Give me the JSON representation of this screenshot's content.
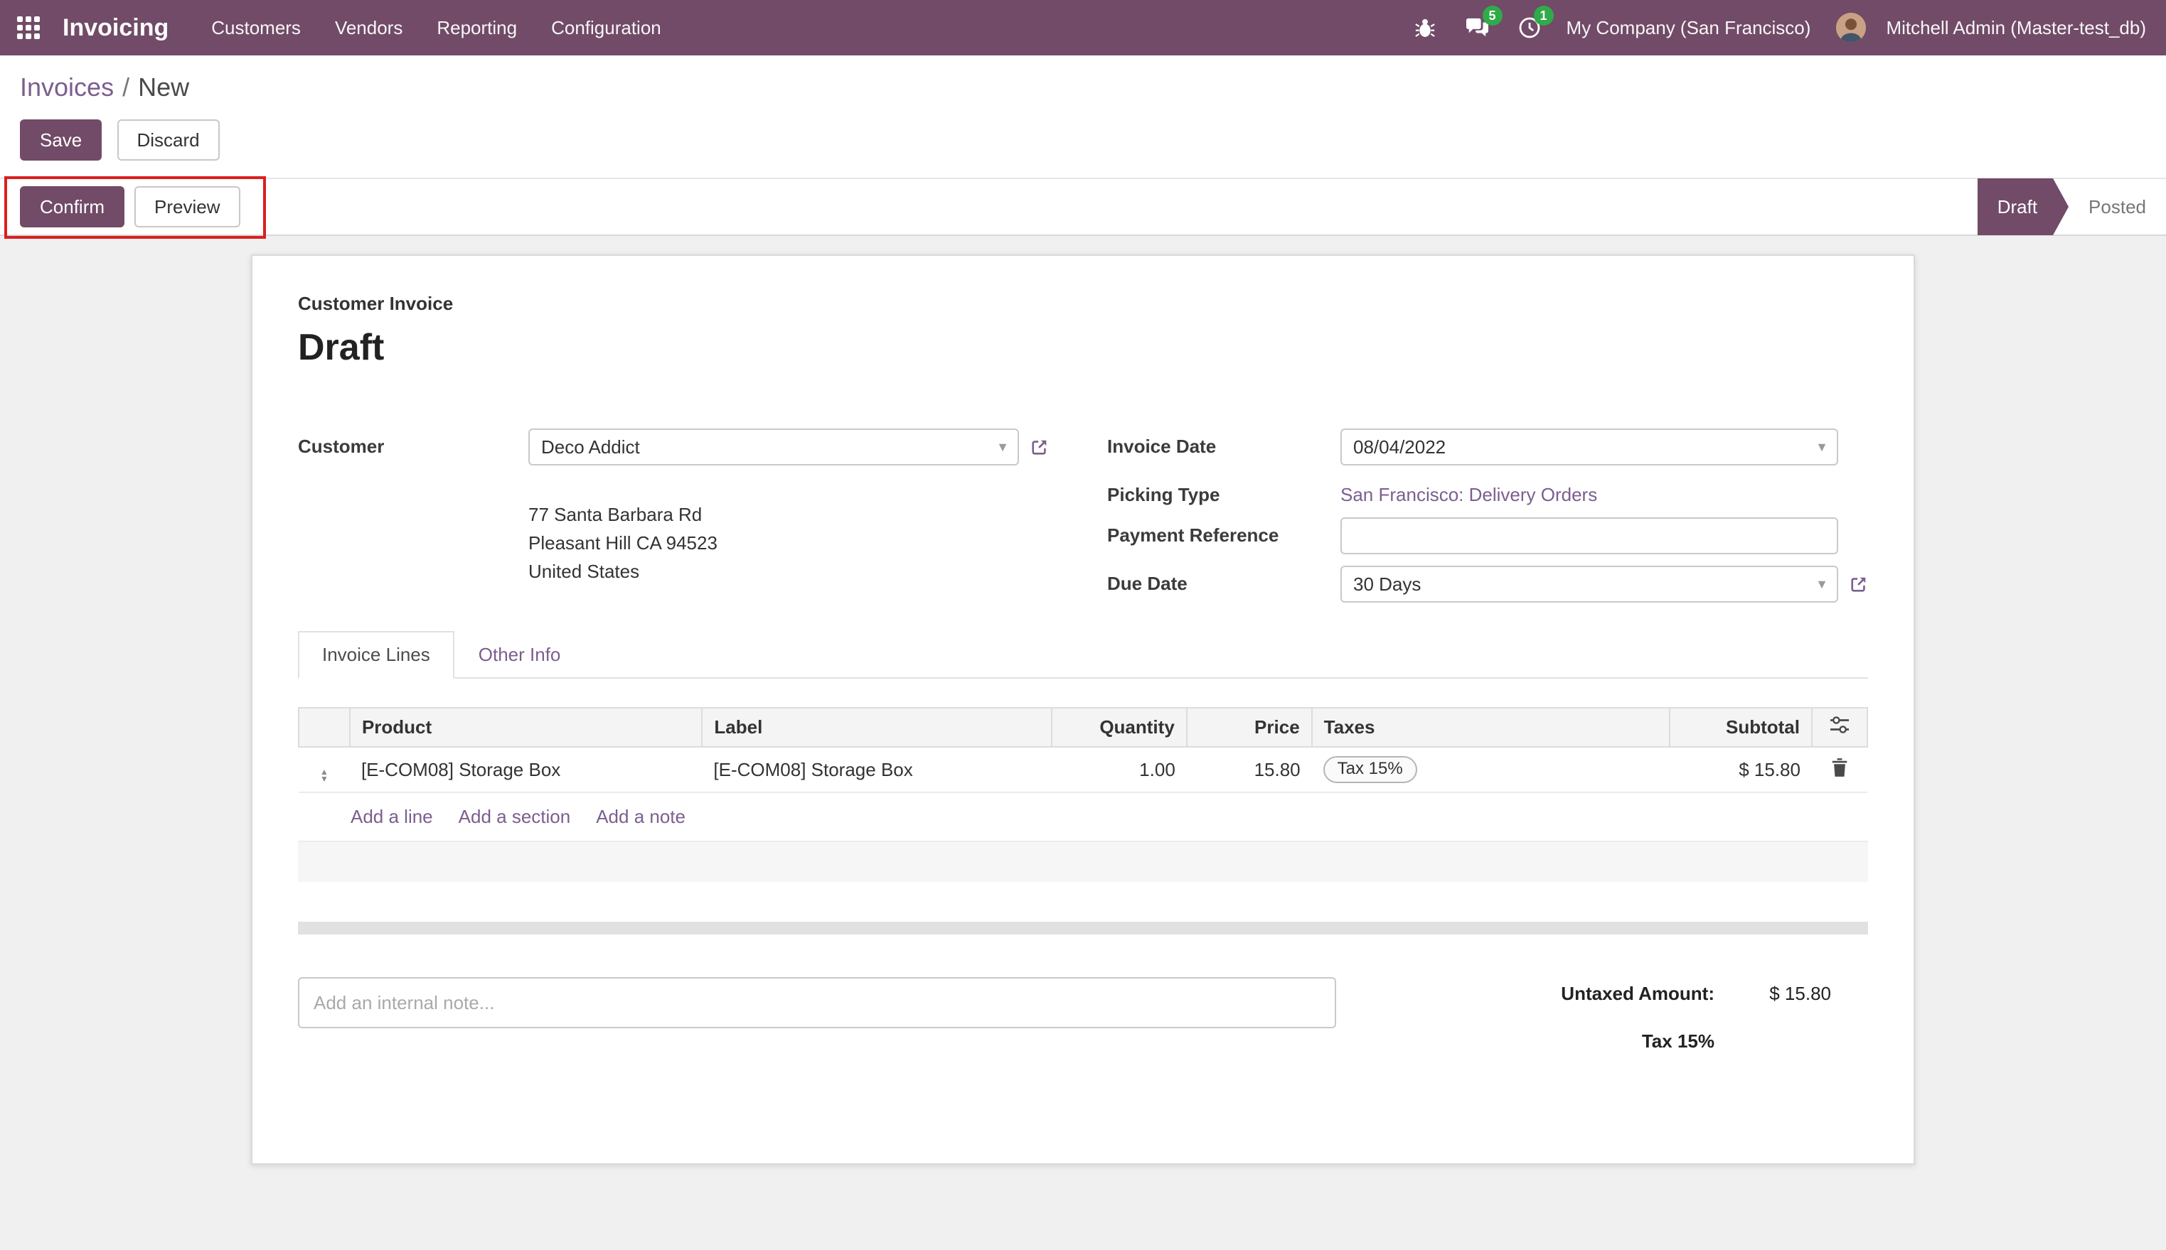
{
  "colors": {
    "primary": "#714B67",
    "link": "#7c5e8f",
    "badge": "#2fab49",
    "annotation": "#db1f1f"
  },
  "icons": {
    "apps": "3x3-grid",
    "debug": "bug",
    "messages": "chat-bubbles",
    "activities": "clock",
    "dropdown": "caret-down",
    "external_link": "box-arrow",
    "drag": "up-down-sort-arrows",
    "delete": "trash",
    "optional_columns": "sliders"
  },
  "nav": {
    "brand": "Invoicing",
    "items": [
      "Customers",
      "Vendors",
      "Reporting",
      "Configuration"
    ],
    "messages_badge": "5",
    "activities_badge": "1",
    "company": "My Company (San Francisco)",
    "user": "Mitchell Admin (Master-test_db)"
  },
  "breadcrumb": {
    "parent": "Invoices",
    "separator": "/",
    "current": "New"
  },
  "actions": {
    "save": "Save",
    "discard": "Discard",
    "confirm": "Confirm",
    "preview": "Preview"
  },
  "statusbar": {
    "states": [
      {
        "label": "Draft",
        "active": true
      },
      {
        "label": "Posted",
        "active": false
      }
    ]
  },
  "sheet": {
    "doc_type": "Customer Invoice",
    "status_title": "Draft",
    "fields": {
      "customer_label": "Customer",
      "customer_value": "Deco Addict",
      "address_lines": [
        "77 Santa Barbara Rd",
        "Pleasant Hill CA 94523",
        "United States"
      ],
      "invoice_date_label": "Invoice Date",
      "invoice_date_value": "08/04/2022",
      "picking_type_label": "Picking Type",
      "picking_type_value": "San Francisco: Delivery Orders",
      "payment_reference_label": "Payment Reference",
      "payment_reference_value": "",
      "due_date_label": "Due Date",
      "due_date_value": "30 Days"
    },
    "tabs": [
      {
        "label": "Invoice Lines",
        "active": true
      },
      {
        "label": "Other Info",
        "active": false
      }
    ],
    "lines": {
      "columns": [
        "Product",
        "Label",
        "Quantity",
        "Price",
        "Taxes",
        "Subtotal"
      ],
      "rows": [
        {
          "product": "[E-COM08] Storage Box",
          "label": "[E-COM08] Storage Box",
          "quantity": "1.00",
          "price": "15.80",
          "taxes": "Tax 15%",
          "subtotal": "$ 15.80"
        }
      ],
      "add_line": "Add a line",
      "add_section": "Add a section",
      "add_note": "Add a note"
    },
    "note_placeholder": "Add an internal note...",
    "totals": {
      "untaxed_label": "Untaxed Amount:",
      "untaxed_value": "$ 15.80",
      "tax_label": "Tax 15%"
    }
  }
}
